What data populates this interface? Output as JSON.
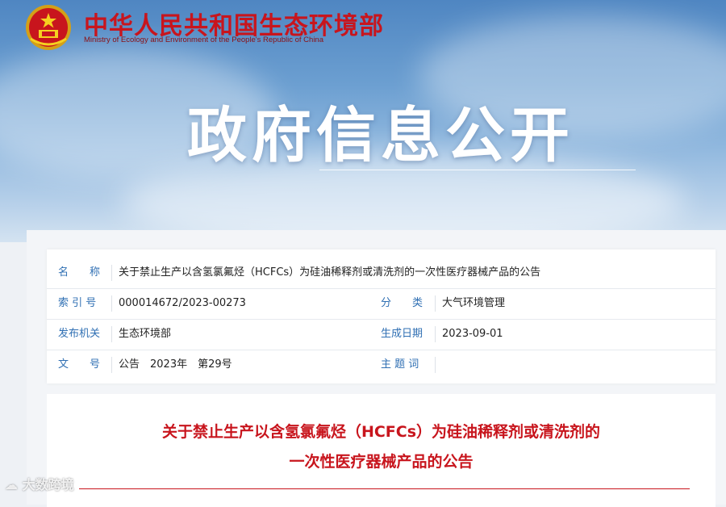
{
  "header": {
    "site_title": "中华人民共和国生态环境部",
    "site_subtitle": "Ministry of Ecology and Environment of the People's Republic of China",
    "hero_title": "政府信息公开"
  },
  "info": {
    "name_label": "名　　称",
    "name_value": "关于禁止生产以含氢氯氟烃（HCFCs）为硅油稀释剂或清洗剂的一次性医疗器械产品的公告",
    "index_label": "索 引 号",
    "index_value": "000014672/2023-00273",
    "category_label": "分　　类",
    "category_value": "大气环境管理",
    "issuer_label": "发布机关",
    "issuer_value": "生态环境部",
    "date_label": "生成日期",
    "date_value": "2023-09-01",
    "docno_label": "文　　号",
    "docno_value": "公告　2023年　第29号",
    "subject_label": "主 题 词",
    "subject_value": ""
  },
  "document": {
    "title_line1": "关于禁止生产以含氢氯氟烃（HCFCs）为硅油稀释剂或清洗剂的",
    "title_line2": "一次性医疗器械产品的公告"
  },
  "watermark": "大数跨境",
  "colors": {
    "accent_red": "#c8151d",
    "label_blue": "#2f6fb3"
  }
}
